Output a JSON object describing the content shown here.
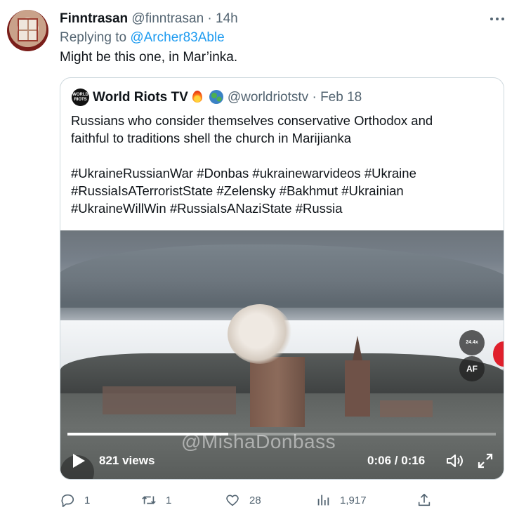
{
  "tweet": {
    "author_name": "Finntrasan",
    "handle": "@finntrasan",
    "separator": "·",
    "time": "14h",
    "replying_prefix": "Replying to ",
    "replying_to": "@Archer83Able",
    "text": "Might be this one, in Mar’inka."
  },
  "quote": {
    "author_name": "World Riots TV",
    "avatar_text": "WORLD RIOTS",
    "handle": "@worldriotstv",
    "separator": "·",
    "date": "Feb 18",
    "icons": [
      "fire-emoji",
      "globe-emoji"
    ],
    "lines": [
      "Russians who consider themselves conservative Orthodox and",
      "faithful to traditions shell the church in Marijianka",
      "",
      "#UkraineRussianWar #Donbas #ukrainewarvideos #Ukraine",
      "#RussiaIsATerroristState #Zelensky #Bakhmut  #Ukrainian",
      "#UkraineWillWin #RussiaIsANaziState #Russia"
    ]
  },
  "video": {
    "views": "821 views",
    "time": "0:06 / 0:16",
    "progress": 0.375,
    "watermark": "@MishaDonbass",
    "speed_badge": "24.4x",
    "af_badge": "AF"
  },
  "actions": {
    "replies": "1",
    "retweets": "1",
    "likes": "28",
    "views": "1,917"
  },
  "colors": {
    "link": "#1d9bf0",
    "muted": "#536471",
    "border": "#cfd9de"
  }
}
